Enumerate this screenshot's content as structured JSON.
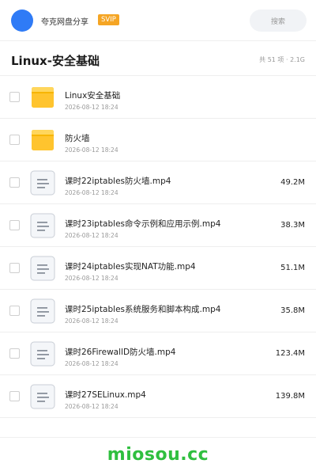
{
  "header": {
    "brand": "夸克网盘分享",
    "badge": "SVIP",
    "search_placeholder": "搜索",
    "avatar_color": "#2f7bf6",
    "badge_color": "#f5a524"
  },
  "folder": {
    "title": "Linux-安全基础",
    "meta": "共 51 项 · 2.1G"
  },
  "files": [
    {
      "type": "folder",
      "icon": "folder-icon",
      "name": "Linux安全基础",
      "date": "2026-08-12 18:24",
      "size": ""
    },
    {
      "type": "folder",
      "icon": "folder-icon",
      "name": "防火墙",
      "date": "2026-08-12 18:24",
      "size": ""
    },
    {
      "type": "file",
      "icon": "document-icon",
      "name": "课时22iptables防火墙.mp4",
      "date": "2026-08-12 18:24",
      "size": "49.2M"
    },
    {
      "type": "file",
      "icon": "document-icon",
      "name": "课时23iptables命令示例和应用示例.mp4",
      "date": "2026-08-12 18:24",
      "size": "38.3M"
    },
    {
      "type": "file",
      "icon": "document-icon",
      "name": "课时24iptables实现NAT功能.mp4",
      "date": "2026-08-12 18:24",
      "size": "51.1M"
    },
    {
      "type": "file",
      "icon": "document-icon",
      "name": "课时25iptables系统服务和脚本构成.mp4",
      "date": "2026-08-12 18:24",
      "size": "35.8M"
    },
    {
      "type": "file",
      "icon": "document-icon",
      "name": "课时26FirewallD防火墙.mp4",
      "date": "2026-08-12 18:24",
      "size": "123.4M"
    },
    {
      "type": "file",
      "icon": "document-icon",
      "name": "课时27SELinux.mp4",
      "date": "2026-08-12 18:24",
      "size": "139.8M"
    }
  ],
  "watermark": "miosou.cc"
}
